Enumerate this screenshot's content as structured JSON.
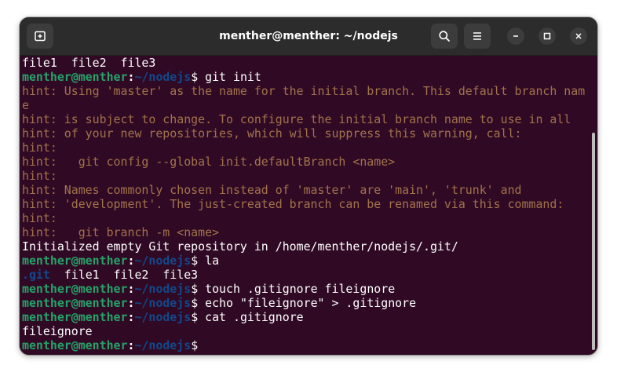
{
  "window": {
    "title": "menther@menther: ~/nodejs"
  },
  "icons": {
    "new_tab": "new-tab-icon",
    "search": "search-icon",
    "menu": "hamburger-menu-icon",
    "minimize": "minimize-icon",
    "maximize": "maximize-icon",
    "close": "close-icon"
  },
  "colors": {
    "terminal_bg": "#300a24",
    "titlebar_bg": "#2c2c2c",
    "prompt_user": "#26a269",
    "prompt_path": "#12488b",
    "hint_text": "#a2734c",
    "default_text": "#ffffff"
  },
  "prompt": {
    "user_host": "menther@menther",
    "colon": ":",
    "path": "~/nodejs",
    "dollar": "$"
  },
  "terminal": {
    "lines": [
      {
        "type": "output",
        "text": "file1  file2  file3"
      },
      {
        "type": "command",
        "text": " git init"
      },
      {
        "type": "hint",
        "text": "hint: Using 'master' as the name for the initial branch. This default branch nam"
      },
      {
        "type": "hint",
        "text": "e"
      },
      {
        "type": "hint",
        "text": "hint: is subject to change. To configure the initial branch name to use in all"
      },
      {
        "type": "hint",
        "text": "hint: of your new repositories, which will suppress this warning, call:"
      },
      {
        "type": "hint",
        "text": "hint:"
      },
      {
        "type": "hint",
        "text": "hint:   git config --global init.defaultBranch <name>"
      },
      {
        "type": "hint",
        "text": "hint:"
      },
      {
        "type": "hint",
        "text": "hint: Names commonly chosen instead of 'master' are 'main', 'trunk' and"
      },
      {
        "type": "hint",
        "text": "hint: 'development'. The just-created branch can be renamed via this command:"
      },
      {
        "type": "hint",
        "text": "hint:"
      },
      {
        "type": "hint",
        "text": "hint:   git branch -m <name>"
      },
      {
        "type": "output",
        "text": "Initialized empty Git repository in /home/menther/nodejs/.git/"
      },
      {
        "type": "command",
        "text": " la"
      },
      {
        "type": "listing",
        "dir": ".git",
        "rest": "  file1  file2  file3"
      },
      {
        "type": "command",
        "text": " touch .gitignore fileignore"
      },
      {
        "type": "command",
        "text": " echo \"fileignore\" > .gitignore"
      },
      {
        "type": "command",
        "text": " cat .gitignore"
      },
      {
        "type": "output",
        "text": "fileignore"
      },
      {
        "type": "command",
        "text": ""
      }
    ]
  }
}
